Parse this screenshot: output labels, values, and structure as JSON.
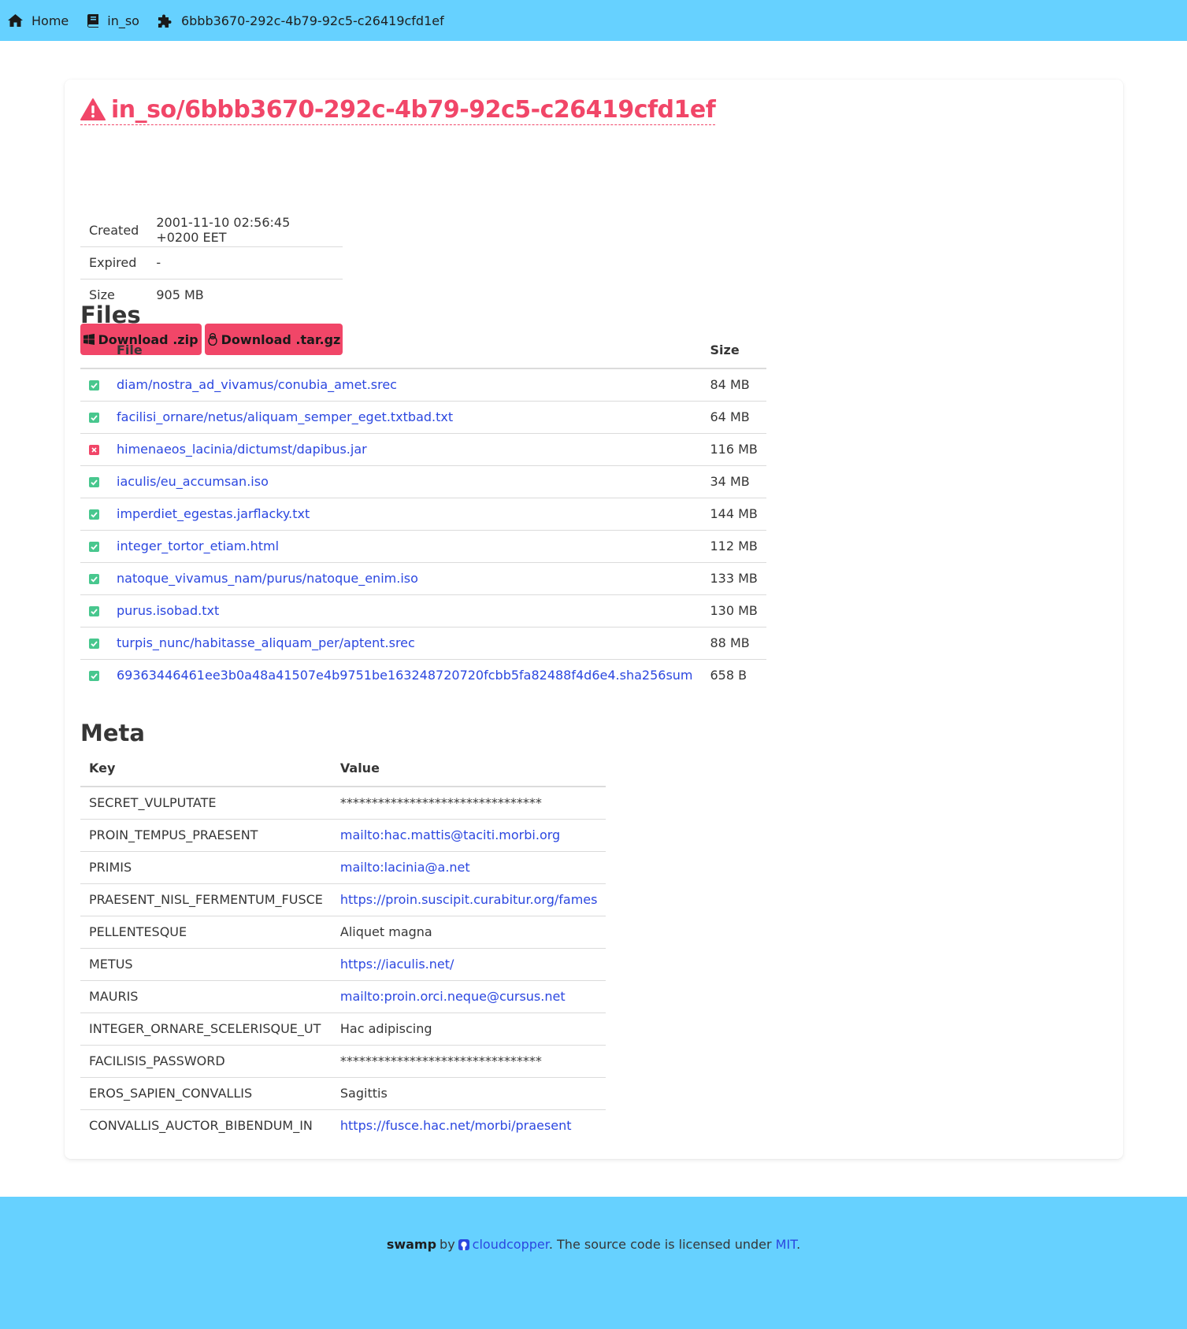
{
  "nav": {
    "home": "Home",
    "bucket": "in_so",
    "artifact": "6bbb3670-292c-4b79-92c5-c26419cfd1ef"
  },
  "title": "in_so/6bbb3670-292c-4b79-92c5-c26419cfd1ef",
  "info": {
    "created_label": "Created",
    "created_value": "2001-11-10 02:56:45 +0200 EET",
    "expired_label": "Expired",
    "expired_value": "-",
    "size_label": "Size",
    "size_value": "905 MB"
  },
  "buttons": {
    "zip": "Download .zip",
    "targz": "Download .tar.gz"
  },
  "files": {
    "heading": "Files",
    "col_file": "File",
    "col_size": "Size",
    "rows": [
      {
        "name": "diam/nostra_ad_vivamus/conubia_amet.srec",
        "size": "84 MB",
        "ok": true
      },
      {
        "name": "facilisi_ornare/netus/aliquam_semper_eget.txtbad.txt",
        "size": "64 MB",
        "ok": true
      },
      {
        "name": "himenaeos_lacinia/dictumst/dapibus.jar",
        "size": "116 MB",
        "ok": false
      },
      {
        "name": "iaculis/eu_accumsan.iso",
        "size": "34 MB",
        "ok": true
      },
      {
        "name": "imperdiet_egestas.jarflacky.txt",
        "size": "144 MB",
        "ok": true
      },
      {
        "name": "integer_tortor_etiam.html",
        "size": "112 MB",
        "ok": true
      },
      {
        "name": "natoque_vivamus_nam/purus/natoque_enim.iso",
        "size": "133 MB",
        "ok": true
      },
      {
        "name": "purus.isobad.txt",
        "size": "130 MB",
        "ok": true
      },
      {
        "name": "turpis_nunc/habitasse_aliquam_per/aptent.srec",
        "size": "88 MB",
        "ok": true
      },
      {
        "name": "69363446461ee3b0a48a41507e4b9751be163248720720fcbb5fa82488f4d6e4.sha256sum",
        "size": "658 B",
        "ok": true
      }
    ]
  },
  "meta": {
    "heading": "Meta",
    "col_key": "Key",
    "col_value": "Value",
    "rows": [
      {
        "key": "SECRET_VULPUTATE",
        "value": "********************************",
        "link": false
      },
      {
        "key": "PROIN_TEMPUS_PRAESENT",
        "value": "mailto:hac.mattis@taciti.morbi.org",
        "link": true
      },
      {
        "key": "PRIMIS",
        "value": "mailto:lacinia@a.net",
        "link": true
      },
      {
        "key": "PRAESENT_NISL_FERMENTUM_FUSCE",
        "value": "https://proin.suscipit.curabitur.org/fames",
        "link": true
      },
      {
        "key": "PELLENTESQUE",
        "value": "Aliquet magna",
        "link": false
      },
      {
        "key": "METUS",
        "value": "https://iaculis.net/",
        "link": true
      },
      {
        "key": "MAURIS",
        "value": "mailto:proin.orci.neque@cursus.net",
        "link": true
      },
      {
        "key": "INTEGER_ORNARE_SCELERISQUE_UT",
        "value": "Hac adipiscing",
        "link": false
      },
      {
        "key": "FACILISIS_PASSWORD",
        "value": "********************************",
        "link": false
      },
      {
        "key": "EROS_SAPIEN_CONVALLIS",
        "value": "Sagittis",
        "link": false
      },
      {
        "key": "CONVALLIS_AUCTOR_BIBENDUM_IN",
        "value": "https://fusce.hac.net/morbi/praesent",
        "link": true
      }
    ]
  },
  "footer": {
    "app": "swamp",
    "by": "by",
    "author": "cloudcopper",
    "license_text": ". The source code is licensed under ",
    "license": "MIT",
    "end": "."
  },
  "colors": {
    "navbar": "#66d1ff",
    "danger": "#f14668",
    "success": "#48c78e",
    "link": "#2b47e0"
  },
  "icons": {
    "home": "home-icon",
    "bucket": "book-icon",
    "artifact": "puzzle-icon",
    "warning": "warning-icon",
    "zip": "windows-icon",
    "targz": "linux-icon",
    "github": "github-icon"
  }
}
